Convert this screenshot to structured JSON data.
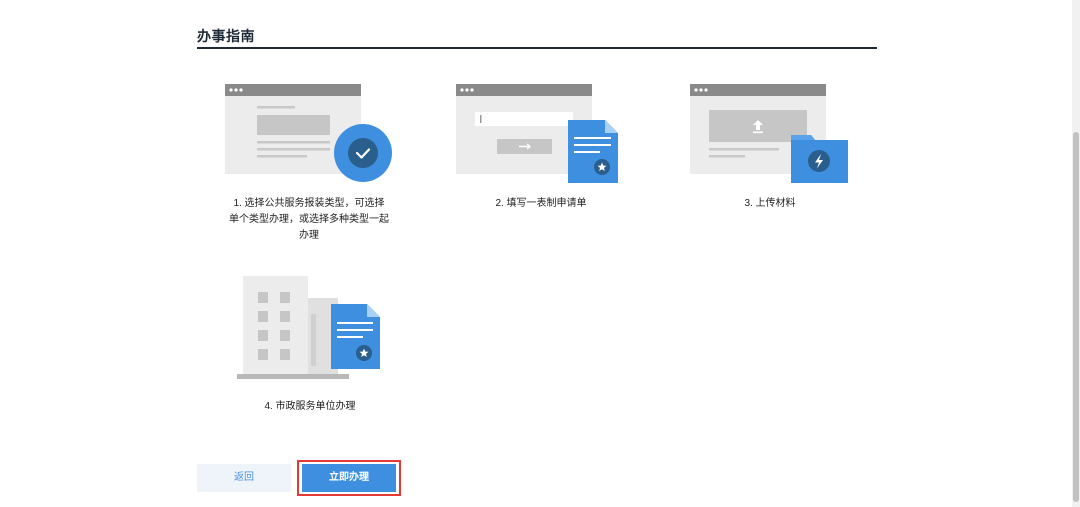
{
  "guide": {
    "title": "办事指南"
  },
  "steps": [
    {
      "caption": "1. 选择公共服务报装类型，可选择单个类型办理，或选择多种类型一起办理",
      "icon": "check-icon"
    },
    {
      "caption": "2. 填写一表制申请单",
      "icon": "form-star-icon"
    },
    {
      "caption": "3. 上传材料",
      "icon": "folder-lightning-icon"
    },
    {
      "caption": "4. 市政服务单位办理",
      "icon": "building-document-icon"
    }
  ],
  "actions": {
    "back_label": "返回",
    "start_label": "立即办理"
  },
  "colors": {
    "accent": "#3e8fe0",
    "highlight_border": "#e53935",
    "title_rule": "#1f2a37"
  }
}
